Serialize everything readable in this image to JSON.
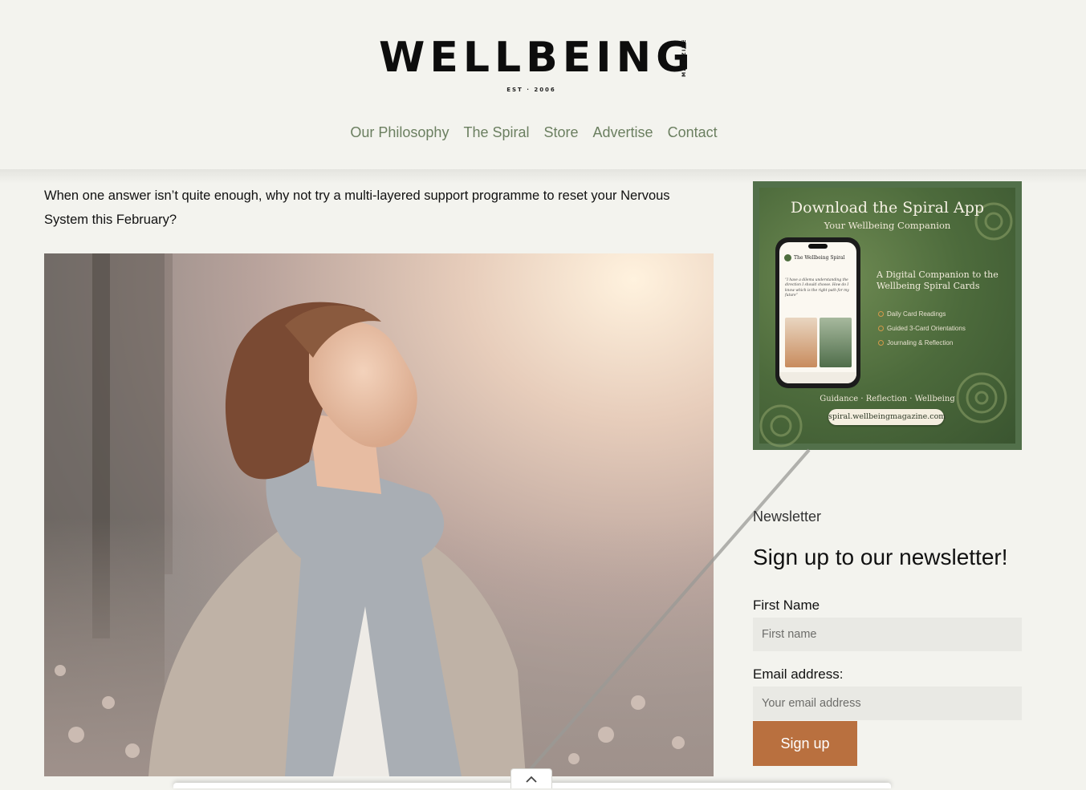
{
  "header": {
    "logo": "WELLBEING",
    "logo_tag": "MAGAZINE",
    "logo_est": "EST · 2006",
    "nav": [
      "Our Philosophy",
      "The Spiral",
      "Store",
      "Advertise",
      "Contact"
    ]
  },
  "article": {
    "intro": "When one answer isn’t quite enough, why not try a multi-layered support programme to reset your Nervous System this February?"
  },
  "ad": {
    "title": "Download the Spiral App",
    "subtitle": "Your Wellbeing Companion",
    "phone_app_name": "The Wellbeing Spiral",
    "phone_question": "“I have a dilema understanding the direction I should choose. How do I know which is the right path for my future”",
    "companion_text": "A Digital Companion to the Wellbeing Spiral Cards",
    "features": [
      "Daily Card Readings",
      "Guided 3-Card Orientations",
      "Journaling & Reflection"
    ],
    "tagline": "Guidance · Reflection · Wellbeing",
    "url": "spiral.wellbeingmagazine.com"
  },
  "newsletter": {
    "label": "Newsletter",
    "heading": "Sign up to our newsletter!",
    "first_name_label": "First Name",
    "first_name_placeholder": "First name",
    "email_label": "Email address:",
    "email_placeholder": "Your email address",
    "submit": "Sign up"
  },
  "scroll_top_icon": "chevron-up-icon",
  "colors": {
    "background": "#f3f3ee",
    "nav_link": "#6b7f60",
    "signup_button": "#b9703f",
    "field_bg": "#e9e9e4"
  }
}
